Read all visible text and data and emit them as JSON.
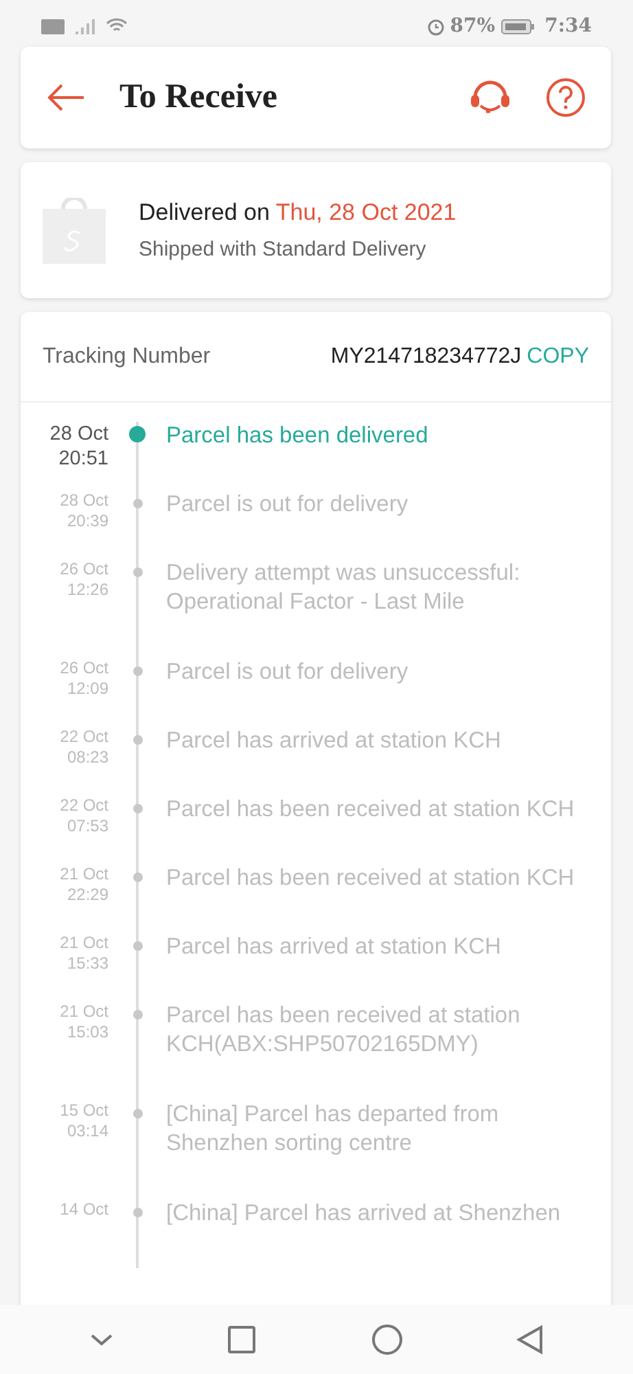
{
  "status_bar": {
    "battery": "87%",
    "time": "7:34"
  },
  "header": {
    "title": "To Receive"
  },
  "delivery": {
    "prefix": "Delivered on",
    "date": "Thu, 28 Oct 2021",
    "subtitle": "Shipped with Standard Delivery"
  },
  "tracking": {
    "label": "Tracking Number",
    "number": "MY214718234772J",
    "action": "COPY"
  },
  "events": [
    {
      "date": "28 Oct",
      "time": "20:51",
      "text": "Parcel has been delivered",
      "current": true
    },
    {
      "date": "28 Oct",
      "time": "20:39",
      "text": "Parcel is out for delivery",
      "current": false
    },
    {
      "date": "26 Oct",
      "time": "12:26",
      "text": "Delivery attempt was unsuccessful: Operational Factor - Last Mile",
      "current": false
    },
    {
      "date": "26 Oct",
      "time": "12:09",
      "text": "Parcel is out for delivery",
      "current": false
    },
    {
      "date": "22 Oct",
      "time": "08:23",
      "text": "Parcel has arrived at station KCH",
      "current": false
    },
    {
      "date": "22 Oct",
      "time": "07:53",
      "text": "Parcel has been received at station KCH",
      "current": false
    },
    {
      "date": "21 Oct",
      "time": "22:29",
      "text": "Parcel has been received at station KCH",
      "current": false
    },
    {
      "date": "21 Oct",
      "time": "15:33",
      "text": "Parcel has arrived at station KCH",
      "current": false
    },
    {
      "date": "21 Oct",
      "time": "15:03",
      "text": "Parcel has been received at station KCH(ABX:SHP50702165DMY)",
      "current": false
    },
    {
      "date": "15 Oct",
      "time": "03:14",
      "text": "[China] Parcel has departed from Shenzhen sorting centre",
      "current": false
    },
    {
      "date": "14 Oct",
      "text": "[China] Parcel has arrived at Shenzhen",
      "current": false
    }
  ]
}
